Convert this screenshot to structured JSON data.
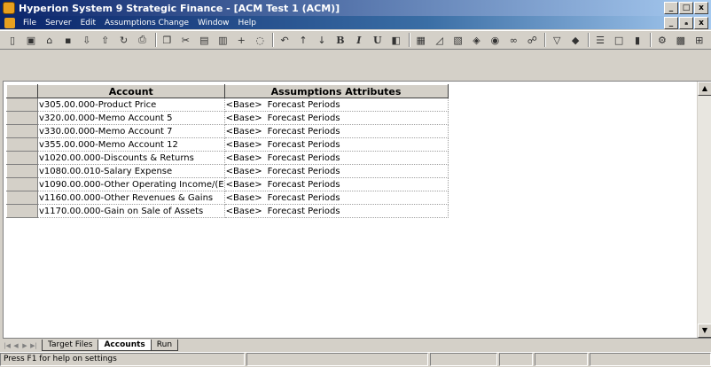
{
  "window": {
    "title": "Hyperion System 9 Strategic Finance - [ACM Test 1  (ACM)]",
    "minimize_glyph": "_",
    "restore_glyph": "□",
    "close_glyph": "x"
  },
  "menubar": {
    "items": [
      "File",
      "Server",
      "Edit",
      "Assumptions Change",
      "Window",
      "Help"
    ],
    "doc_minimize_glyph": "_",
    "doc_restore_glyph": "ₐ",
    "doc_close_glyph": "x"
  },
  "toolbar": {
    "icons": [
      "new-icon",
      "print-preview-icon",
      "open-folder-icon",
      "save-icon",
      "import-icon",
      "export-icon",
      "refresh-icon",
      "print-icon",
      "copy-icon",
      "cut-icon",
      "paste-icon",
      "paste-special-icon",
      "insert-icon",
      "clear-icon",
      "undo-icon",
      "sort-ascending-icon",
      "sort-descending-icon",
      "bold-icon",
      "italic-icon",
      "underline-icon",
      "format-icon",
      "grid-icon",
      "chart-icon",
      "report-icon",
      "filter-icon",
      "filter-options-icon",
      "link-icon",
      "binoculars-icon",
      "funnel-icon",
      "dimension-icon",
      "options-icon",
      "window-icon",
      "bar-chart-icon",
      "settings-icon",
      "calculator-icon",
      "network-icon"
    ],
    "bold_glyph": "B",
    "italic_glyph": "I",
    "underline_glyph": "U"
  },
  "grid": {
    "columns": [
      "Account",
      "Assumptions Attributes"
    ],
    "rows": [
      {
        "account": "v305.00.000-Product Price",
        "base": "<Base>",
        "attribute": "Forecast Periods"
      },
      {
        "account": "v320.00.000-Memo Account 5",
        "base": "<Base>",
        "attribute": "Forecast Periods"
      },
      {
        "account": "v330.00.000-Memo Account 7",
        "base": "<Base>",
        "attribute": "Forecast Periods"
      },
      {
        "account": "v355.00.000-Memo Account 12",
        "base": "<Base>",
        "attribute": "Forecast Periods"
      },
      {
        "account": "v1020.00.000-Discounts & Returns",
        "base": "<Base>",
        "attribute": "Forecast Periods"
      },
      {
        "account": "v1080.00.010-Salary Expense",
        "base": "<Base>",
        "attribute": "Forecast Periods"
      },
      {
        "account": "v1090.00.000-Other Operating Income/(E",
        "base": "<Base>",
        "attribute": "Forecast Periods"
      },
      {
        "account": "v1160.00.000-Other Revenues & Gains",
        "base": "<Base>",
        "attribute": "Forecast Periods"
      },
      {
        "account": "v1170.00.000-Gain on Sale of Assets",
        "base": "<Base>",
        "attribute": "Forecast Periods"
      }
    ],
    "scroll_up_glyph": "▲",
    "scroll_down_glyph": "▼"
  },
  "tabs": {
    "nav": [
      "|◀",
      "◀",
      "▶",
      "▶|"
    ],
    "items": [
      "Target Files",
      "Accounts",
      "Run"
    ],
    "active": "Accounts"
  },
  "statusbar": {
    "message": "Press F1 for help on settings"
  }
}
